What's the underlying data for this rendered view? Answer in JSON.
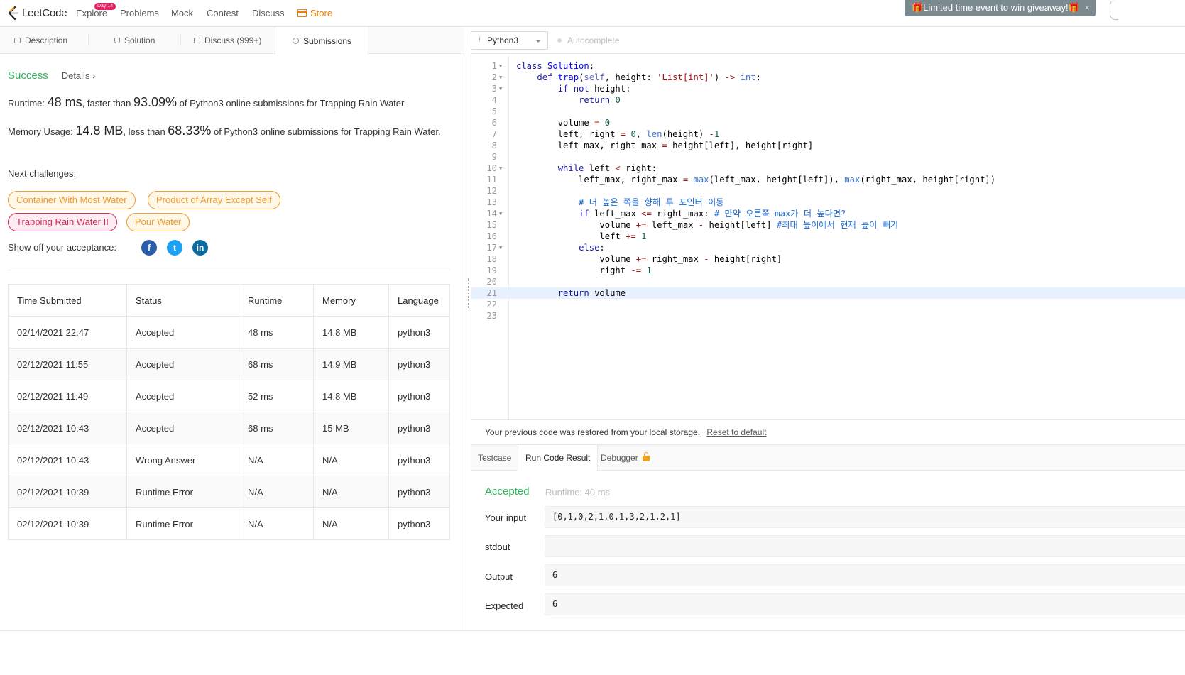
{
  "nav": {
    "logo_text": "LeetCode",
    "items": [
      "Explore",
      "Problems",
      "Mock",
      "Contest",
      "Discuss",
      "Store"
    ],
    "explore_badge": "Day 14",
    "promo": "🎁Limited time event to win giveaway!🎁",
    "promo_close": "×"
  },
  "left_tabs": [
    "Description",
    "Solution",
    "Discuss (999+)",
    "Submissions"
  ],
  "result": {
    "status": "Success",
    "details": "Details ›",
    "runtime_prefix": "Runtime: ",
    "runtime_value": "48 ms",
    "runtime_mid": ", faster than ",
    "runtime_pct": "93.09%",
    "runtime_suffix": " of Python3 online submissions for Trapping Rain Water.",
    "memory_prefix": "Memory Usage: ",
    "memory_value": "14.8 MB",
    "memory_mid": ", less than ",
    "memory_pct": "68.33%",
    "memory_suffix": " of Python3 online submissions for Trapping Rain Water.",
    "next_label": "Next challenges:",
    "challenges": [
      {
        "label": "Container With Most Water",
        "difficulty": "medium"
      },
      {
        "label": "Product of Array Except Self",
        "difficulty": "medium"
      },
      {
        "label": "Trapping Rain Water II",
        "difficulty": "hard"
      },
      {
        "label": "Pour Water",
        "difficulty": "medium"
      }
    ],
    "share_label": "Show off your acceptance:",
    "social_icons": [
      "facebook-icon",
      "twitter-icon",
      "linkedin-icon"
    ],
    "social_glyphs": [
      "f",
      "t",
      "in"
    ]
  },
  "submissions": {
    "headers": [
      "Time Submitted",
      "Status",
      "Runtime",
      "Memory",
      "Language"
    ],
    "rows": [
      [
        "02/14/2021 22:47",
        "Accepted",
        "48 ms",
        "14.8 MB",
        "python3"
      ],
      [
        "02/12/2021 11:55",
        "Accepted",
        "68 ms",
        "14.9 MB",
        "python3"
      ],
      [
        "02/12/2021 11:49",
        "Accepted",
        "52 ms",
        "14.8 MB",
        "python3"
      ],
      [
        "02/12/2021 10:43",
        "Accepted",
        "68 ms",
        "15 MB",
        "python3"
      ],
      [
        "02/12/2021 10:43",
        "Wrong Answer",
        "N/A",
        "N/A",
        "python3"
      ],
      [
        "02/12/2021 10:39",
        "Runtime Error",
        "N/A",
        "N/A",
        "python3"
      ],
      [
        "02/12/2021 10:39",
        "Runtime Error",
        "N/A",
        "N/A",
        "python3"
      ]
    ]
  },
  "editor": {
    "language": "Python3",
    "language_icon": "i",
    "autocomplete": "Autocomplete",
    "code_lines": [
      "class Solution:",
      "    def trap(self, height: 'List[int]') -> int:",
      "        if not height:",
      "            return 0",
      "",
      "        volume = 0",
      "        left, right = 0, len(height) -1",
      "        left_max, right_max = height[left], height[right]",
      "",
      "        while left < right:",
      "            left_max, right_max = max(left_max, height[left]), max(right_max, height[right])",
      "",
      "            # 더 높은 쪽을 향해 투 포인터 이동",
      "            if left_max <= right_max: # 만약 오른쪽 max가 더 높다면?",
      "                volume += left_max - height[left] #최대 높이에서 현재 높이 빼기",
      "                left += 1",
      "            else:",
      "                volume += right_max - height[right]",
      "                right -= 1",
      "",
      "        return volume",
      "",
      ""
    ],
    "fold_lines": [
      1,
      2,
      3,
      10,
      14,
      17
    ],
    "highlight_line": 21
  },
  "restore": {
    "text": "Your previous code was restored from your local storage.",
    "link": "Reset to default"
  },
  "result_tabs": [
    "Testcase",
    "Run Code Result",
    "Debugger"
  ],
  "run_result": {
    "status": "Accepted",
    "runtime": "Runtime: 40 ms",
    "input_label": "Your input",
    "input_value": "[0,1,0,2,1,0,1,3,2,1,2,1]",
    "stdout_label": "stdout",
    "stdout_value": "",
    "output_label": "Output",
    "output_value": "6",
    "expected_label": "Expected",
    "expected_value": "6"
  },
  "colors": {
    "accent_green": "#2db55d",
    "error_red": "#d8261f",
    "medium_orange": "#ef9b2f",
    "hard_pink": "#cb2b55",
    "store_orange": "#f57c00"
  }
}
